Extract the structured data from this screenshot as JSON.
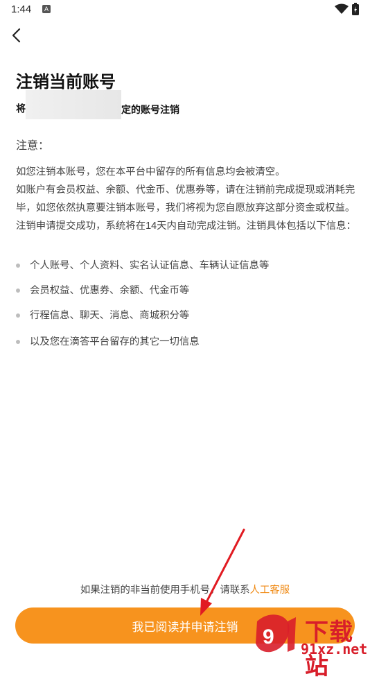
{
  "status_bar": {
    "time": "1:44",
    "notification_icon": "A"
  },
  "header": {
    "back_icon": "chevron-left-icon"
  },
  "page": {
    "title": "注销当前账号",
    "subtitle_start": "将",
    "subtitle_end": "定的账号注销",
    "notice_label": "注意：",
    "paragraph1": "如您注销本账号，您在本平台中留存的所有信息均会被清空。",
    "paragraph2": " 如账户有会员权益、余额、代金币、优惠券等，请在注销前完成提现或消耗完毕，如您依然执意要注销本账号，我们将视为您自愿放弃这部分资金或权益。注销申请提交成功，系统将在14天内自动完成注销。注销具体包括以下信息：",
    "bullets": [
      "个人账号、个人资料、实名认证信息、车辆认证信息等",
      "会员权益、优惠券、余额、代金币等",
      "行程信息、聊天、消息、商城积分等",
      "以及您在滴答平台留存的其它一切信息"
    ]
  },
  "footer": {
    "contact_text": "如果注销的非当前使用手机号，请联系",
    "contact_link": "人工客服",
    "submit_label": "我已阅读并申请注销"
  },
  "watermark": {
    "text": "下载站",
    "url": "91xz.net"
  },
  "colors": {
    "accent": "#f7931e",
    "link": "#f08a14",
    "watermark": "#d81e2a",
    "arrow": "#e11b22"
  }
}
